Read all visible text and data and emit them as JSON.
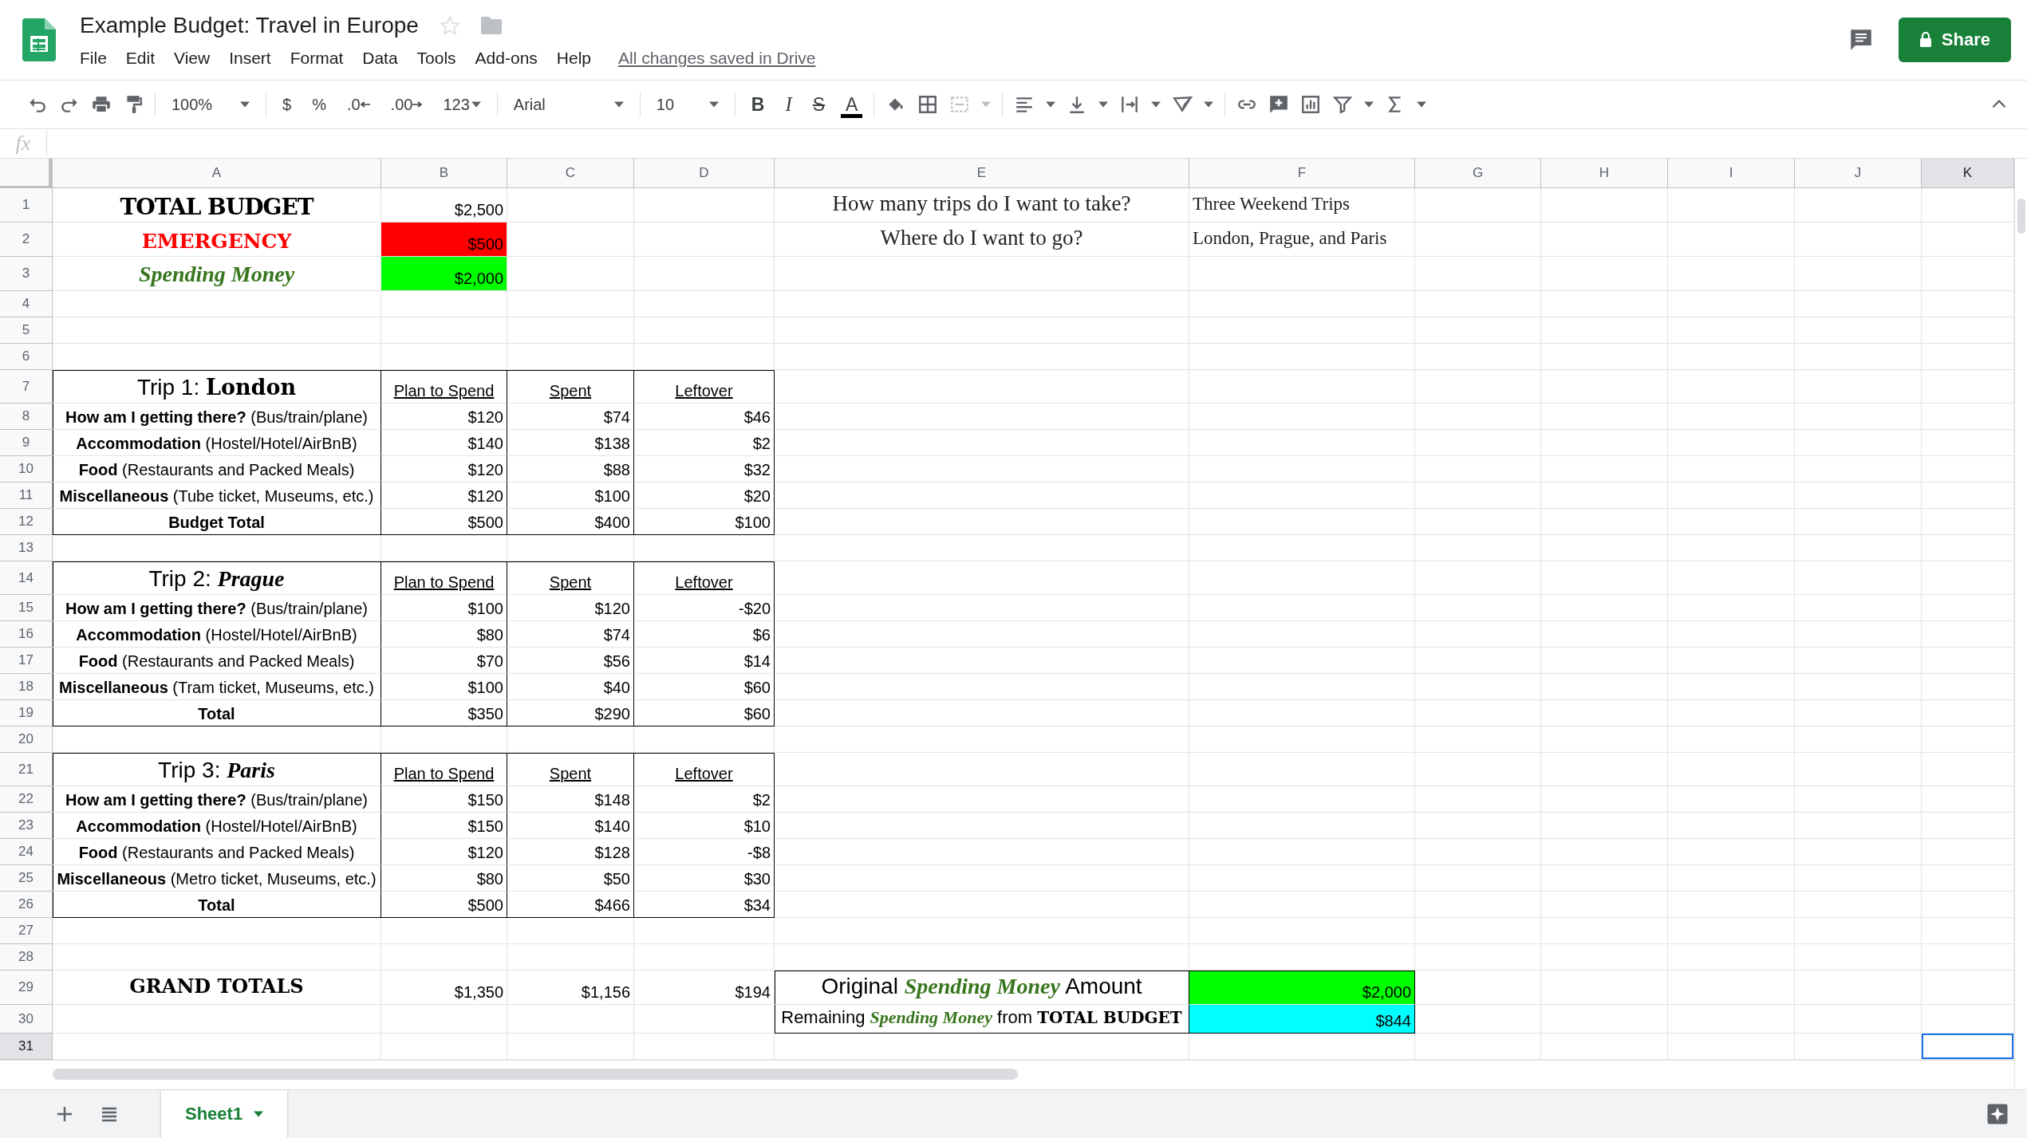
{
  "document": {
    "title": "Example Budget: Travel in Europe",
    "save_status": "All changes saved in Drive"
  },
  "menu": [
    "File",
    "Edit",
    "View",
    "Insert",
    "Format",
    "Data",
    "Tools",
    "Add-ons",
    "Help"
  ],
  "share_button": "Share",
  "toolbar": {
    "zoom": "100%",
    "currency": "$",
    "percent": "%",
    "decrease_decimals": ".0",
    "increase_decimals": ".00",
    "number_format": "123",
    "font": "Arial",
    "font_size": "10",
    "bold": "B",
    "italic": "I",
    "strikethrough": "S",
    "text_color": "A"
  },
  "formula_bar": {
    "label": "fx"
  },
  "columns": [
    {
      "label": "A",
      "selected": false
    },
    {
      "label": "B",
      "selected": false
    },
    {
      "label": "C",
      "selected": false
    },
    {
      "label": "D",
      "selected": false
    },
    {
      "label": "E",
      "selected": false
    },
    {
      "label": "F",
      "selected": false
    },
    {
      "label": "G",
      "selected": false
    },
    {
      "label": "H",
      "selected": false
    },
    {
      "label": "I",
      "selected": false
    },
    {
      "label": "J",
      "selected": false
    },
    {
      "label": "K",
      "selected": true
    }
  ],
  "rows": [
    {
      "number": "1",
      "selected": false,
      "cells": {
        "A": {
          "kind": "title",
          "text": "TOTAL BUDGET"
        },
        "B": {
          "kind": "number",
          "text": "$2,500"
        },
        "E": {
          "kind": "question",
          "text": "How many trips do I want to take?"
        },
        "F": {
          "kind": "answer",
          "text": "Three Weekend Trips"
        }
      }
    },
    {
      "number": "2",
      "selected": false,
      "cells": {
        "A": {
          "kind": "emergency",
          "text": "EMERGENCY"
        },
        "B": {
          "kind": "number",
          "text": "$500",
          "color": "#ff0000"
        },
        "E": {
          "kind": "question",
          "text": "Where do I want to go?"
        },
        "F": {
          "kind": "answer",
          "text": "London, Prague, and Paris"
        }
      }
    },
    {
      "number": "3",
      "selected": false,
      "cells": {
        "A": {
          "kind": "spending",
          "text": "Spending Money"
        },
        "B": {
          "kind": "number",
          "text": "$2,000",
          "color": "#00ff00"
        }
      }
    },
    {
      "number": "4",
      "selected": false
    },
    {
      "number": "5",
      "selected": false
    },
    {
      "number": "6",
      "selected": false
    },
    {
      "number": "7",
      "selected": false,
      "cells": {
        "A": {
          "kind": "trip",
          "text": "Trip 1: **London**",
          "boxed": true
        },
        "B": {
          "kind": "heading",
          "text": "Plan to Spend",
          "boxed": true
        },
        "C": {
          "kind": "heading",
          "text": "Spent",
          "boxed": true
        },
        "D": {
          "kind": "heading",
          "text": "Leftover",
          "boxed": true
        }
      }
    },
    {
      "number": "8",
      "selected": false,
      "cells": {
        "A": {
          "kind": "label",
          "text": "**How am I getting there?** (Bus/train/plane)",
          "boxed": true
        },
        "B": {
          "kind": "number",
          "text": "$120",
          "boxed": true
        },
        "C": {
          "kind": "number",
          "text": "$74",
          "boxed": true
        },
        "D": {
          "kind": "number",
          "text": "$46",
          "boxed": true
        }
      }
    },
    {
      "number": "9",
      "selected": false,
      "cells": {
        "A": {
          "kind": "label",
          "text": "**Accommodation** (Hostel/Hotel/AirBnB)",
          "boxed": true
        },
        "B": {
          "kind": "number",
          "text": "$140",
          "boxed": true
        },
        "C": {
          "kind": "number",
          "text": "$138",
          "boxed": true
        },
        "D": {
          "kind": "number",
          "text": "$2",
          "boxed": true
        }
      }
    },
    {
      "number": "10",
      "selected": false,
      "cells": {
        "A": {
          "kind": "label",
          "text": "**Food** (Restaurants and Packed Meals)",
          "boxed": true
        },
        "B": {
          "kind": "number",
          "text": "$120",
          "boxed": true
        },
        "C": {
          "kind": "number",
          "text": "$88",
          "boxed": true
        },
        "D": {
          "kind": "number",
          "text": "$32",
          "boxed": true
        }
      }
    },
    {
      "number": "11",
      "selected": false,
      "cells": {
        "A": {
          "kind": "label",
          "text": "**Miscellaneous** (Tube ticket, Museums, etc.)",
          "boxed": true
        },
        "B": {
          "kind": "number",
          "text": "$120",
          "boxed": true
        },
        "C": {
          "kind": "number",
          "text": "$100",
          "boxed": true
        },
        "D": {
          "kind": "number",
          "text": "$20",
          "boxed": true
        }
      }
    },
    {
      "number": "12",
      "selected": false,
      "cells": {
        "A": {
          "kind": "total",
          "text": "Budget Total",
          "boxed": true
        },
        "B": {
          "kind": "number",
          "text": "$500",
          "boxed": true
        },
        "C": {
          "kind": "number",
          "text": "$400",
          "boxed": true
        },
        "D": {
          "kind": "number",
          "text": "$100",
          "boxed": true
        }
      }
    },
    {
      "number": "13",
      "selected": false
    },
    {
      "number": "14",
      "selected": false,
      "cells": {
        "A": {
          "kind": "trip",
          "text": "Trip 2: *Prague*",
          "boxed": true
        },
        "B": {
          "kind": "heading",
          "text": "Plan to Spend",
          "boxed": true
        },
        "C": {
          "kind": "heading",
          "text": "Spent",
          "boxed": true
        },
        "D": {
          "kind": "heading",
          "text": "Leftover",
          "boxed": true
        }
      }
    },
    {
      "number": "15",
      "selected": false,
      "cells": {
        "A": {
          "kind": "label",
          "text": "**How am I getting there?** (Bus/train/plane)",
          "boxed": true
        },
        "B": {
          "kind": "number",
          "text": "$100",
          "boxed": true
        },
        "C": {
          "kind": "number",
          "text": "$120",
          "boxed": true
        },
        "D": {
          "kind": "number",
          "text": "-$20",
          "boxed": true
        }
      }
    },
    {
      "number": "16",
      "selected": false,
      "cells": {
        "A": {
          "kind": "label",
          "text": "**Accommodation** (Hostel/Hotel/AirBnB)",
          "boxed": true
        },
        "B": {
          "kind": "number",
          "text": "$80",
          "boxed": true
        },
        "C": {
          "kind": "number",
          "text": "$74",
          "boxed": true
        },
        "D": {
          "kind": "number",
          "text": "$6",
          "boxed": true
        }
      }
    },
    {
      "number": "17",
      "selected": false,
      "cells": {
        "A": {
          "kind": "label",
          "text": "**Food** (Restaurants and Packed Meals)",
          "boxed": true
        },
        "B": {
          "kind": "number",
          "text": "$70",
          "boxed": true
        },
        "C": {
          "kind": "number",
          "text": "$56",
          "boxed": true
        },
        "D": {
          "kind": "number",
          "text": "$14",
          "boxed": true
        }
      }
    },
    {
      "number": "18",
      "selected": false,
      "cells": {
        "A": {
          "kind": "label",
          "text": "**Miscellaneous** (Tram ticket, Museums, etc.)",
          "boxed": true
        },
        "B": {
          "kind": "number",
          "text": "$100",
          "boxed": true
        },
        "C": {
          "kind": "number",
          "text": "$40",
          "boxed": true
        },
        "D": {
          "kind": "number",
          "text": "$60",
          "boxed": true
        }
      }
    },
    {
      "number": "19",
      "selected": false,
      "cells": {
        "A": {
          "kind": "total",
          "text": "Total",
          "boxed": true
        },
        "B": {
          "kind": "number",
          "text": "$350",
          "boxed": true
        },
        "C": {
          "kind": "number",
          "text": "$290",
          "boxed": true
        },
        "D": {
          "kind": "number",
          "text": "$60",
          "boxed": true
        }
      }
    },
    {
      "number": "20",
      "selected": false
    },
    {
      "number": "21",
      "selected": false,
      "cells": {
        "A": {
          "kind": "trip",
          "text": "Trip 3: *Paris*",
          "boxed": true
        },
        "B": {
          "kind": "heading",
          "text": "Plan to Spend",
          "boxed": true
        },
        "C": {
          "kind": "heading",
          "text": "Spent",
          "boxed": true
        },
        "D": {
          "kind": "heading",
          "text": "Leftover",
          "boxed": true
        }
      }
    },
    {
      "number": "22",
      "selected": false,
      "cells": {
        "A": {
          "kind": "label",
          "text": "**How am I getting there?** (Bus/train/plane)",
          "boxed": true
        },
        "B": {
          "kind": "number",
          "text": "$150",
          "boxed": true
        },
        "C": {
          "kind": "number",
          "text": "$148",
          "boxed": true
        },
        "D": {
          "kind": "number",
          "text": "$2",
          "boxed": true
        }
      }
    },
    {
      "number": "23",
      "selected": false,
      "cells": {
        "A": {
          "kind": "label",
          "text": "**Accommodation** (Hostel/Hotel/AirBnB)",
          "boxed": true
        },
        "B": {
          "kind": "number",
          "text": "$150",
          "boxed": true
        },
        "C": {
          "kind": "number",
          "text": "$140",
          "boxed": true
        },
        "D": {
          "kind": "number",
          "text": "$10",
          "boxed": true
        }
      }
    },
    {
      "number": "24",
      "selected": false,
      "cells": {
        "A": {
          "kind": "label",
          "text": "**Food** (Restaurants and Packed Meals)",
          "boxed": true
        },
        "B": {
          "kind": "number",
          "text": "$120",
          "boxed": true
        },
        "C": {
          "kind": "number",
          "text": "$128",
          "boxed": true
        },
        "D": {
          "kind": "number",
          "text": "-$8",
          "boxed": true
        }
      }
    },
    {
      "number": "25",
      "selected": false,
      "cells": {
        "A": {
          "kind": "label",
          "text": "**Miscellaneous** (Metro ticket, Museums, etc.)",
          "boxed": true
        },
        "B": {
          "kind": "number",
          "text": "$80",
          "boxed": true
        },
        "C": {
          "kind": "number",
          "text": "$50",
          "boxed": true
        },
        "D": {
          "kind": "number",
          "text": "$30",
          "boxed": true
        }
      }
    },
    {
      "number": "26",
      "selected": false,
      "cells": {
        "A": {
          "kind": "total",
          "text": "Total",
          "boxed": true
        },
        "B": {
          "kind": "number",
          "text": "$500",
          "boxed": true
        },
        "C": {
          "kind": "number",
          "text": "$466",
          "boxed": true
        },
        "D": {
          "kind": "number",
          "text": "$34",
          "boxed": true
        }
      }
    },
    {
      "number": "27",
      "selected": false
    },
    {
      "number": "28",
      "selected": false
    },
    {
      "number": "29",
      "selected": false,
      "cells": {
        "A": {
          "kind": "grand",
          "text": "GRAND TOTALS"
        },
        "B": {
          "kind": "number",
          "text": "$1,350"
        },
        "C": {
          "kind": "number",
          "text": "$1,156"
        },
        "D": {
          "kind": "number",
          "text": "$194"
        },
        "E": {
          "kind": "summary",
          "text": "Original *Spending Money* Amount",
          "boxed": true
        },
        "F": {
          "kind": "number",
          "text": "$2,000",
          "color": "#00ff00",
          "boxed": true
        }
      }
    },
    {
      "number": "30",
      "selected": false,
      "cells": {
        "E": {
          "kind": "remainder",
          "text": "Remaining *Spending Money* from **TOTAL BUDGET**",
          "boxed": true
        },
        "F": {
          "kind": "number",
          "text": "$844",
          "color": "#00ffff",
          "boxed": true
        }
      }
    },
    {
      "number": "31",
      "selected": true
    }
  ],
  "sheets": [
    {
      "label": "Sheet1",
      "selected": true
    }
  ]
}
